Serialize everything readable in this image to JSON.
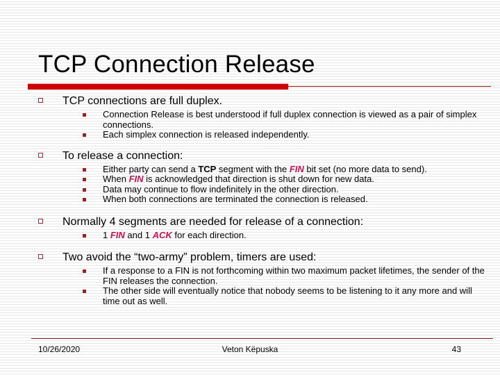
{
  "slide": {
    "title": "TCP Connection Release",
    "accent_color": "#cc0000",
    "rule_color": "#8b1a1a",
    "keyword_color": "#c41254",
    "bullet_level1_color": "#b02020",
    "bullet_level2_color": "#a51c1c"
  },
  "content": {
    "blocks": [
      {
        "heading": "TCP connections are full duplex.",
        "items": [
          "Connection Release is best understood if full duplex connection is viewed as a pair of simplex connections.",
          "Each simplex connection is released independently."
        ]
      },
      {
        "heading": "To release a connection:",
        "items": [
          "Either party can send a TCP segment with the FIN bit set (no more data to send).",
          "When FIN is acknowledged that direction is shut down for new data.",
          "Data may continue to flow indefinitely in the other direction.",
          "When both connections are terminated the connection is released."
        ]
      },
      {
        "heading": "Normally 4 segments are needed for release of a connection:",
        "items": [
          "1 FIN and 1 ACK for each direction."
        ]
      },
      {
        "heading": "Two avoid the “two-army” problem, timers are used:",
        "items": [
          "If a response to a FIN is not forthcoming within two maximum packet lifetimes, the sender of the FIN releases the connection.",
          "The other side will eventually notice that nobody seems to be listening to it any more and will time out as well."
        ]
      }
    ],
    "fragments": {
      "b2i1_a": "Either party can send a ",
      "b2i1_tcp": "TCP",
      "b2i1_b": " segment with the ",
      "b2i1_fin": "FIN",
      "b2i1_c": " bit set (no more data to send).",
      "b2i2_a": "When ",
      "b2i2_fin": "FIN",
      "b2i2_b": " is acknowledged that direction is shut down for new data.",
      "b3i1_a": "1 ",
      "b3i1_fin": "FIN",
      "b3i1_b": " and 1 ",
      "b3i1_ack": "ACK",
      "b3i1_c": " for each direction."
    }
  },
  "footer": {
    "date": "10/26/2020",
    "author": "Veton Këpuska",
    "page_number": "43"
  }
}
